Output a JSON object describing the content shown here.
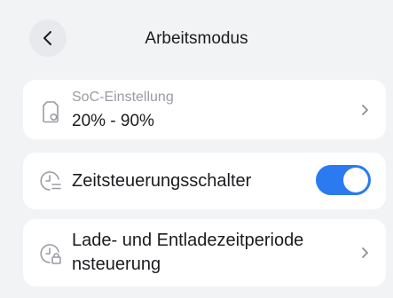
{
  "header": {
    "title": "Arbeitsmodus"
  },
  "soc_setting": {
    "label": "SoC-Einstellung",
    "value": "20% - 90%"
  },
  "time_control_switch": {
    "label": "Zeitsteuerungsschalter",
    "enabled": true
  },
  "charge_period": {
    "label": "Lade- und Entladezeitperiode nsteuerung"
  },
  "colors": {
    "background": "#f2f3f5",
    "card": "#ffffff",
    "accent": "#2b7af0",
    "secondary_text": "#9a9ca3"
  },
  "icons": {
    "back": "chevron-left-icon",
    "soc": "battery-cycle-icon",
    "time_switch": "clock-switch-icon",
    "period": "clock-lock-icon",
    "chevron": "chevron-right-icon"
  }
}
